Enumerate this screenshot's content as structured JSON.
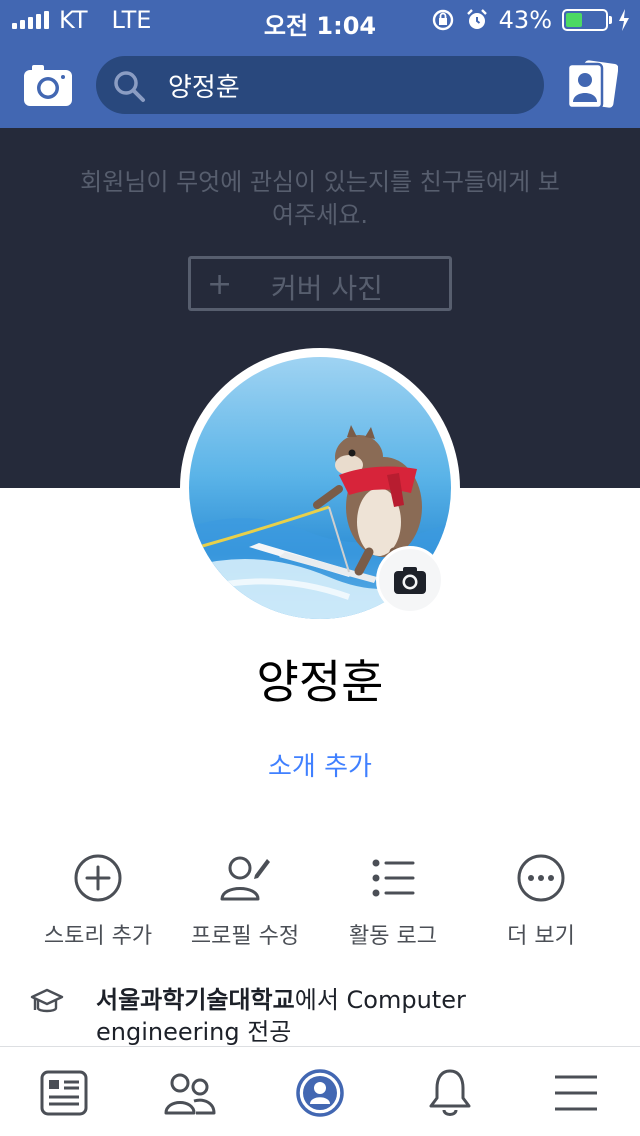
{
  "status_bar": {
    "carrier": "KT",
    "network": "LTE",
    "time": "오전 1:04",
    "battery_percent": "43%",
    "battery_level": 0.43
  },
  "nav": {
    "search_value": "양정훈"
  },
  "cover": {
    "message": "회원님이 무엇에 관심이 있는지를 친구들에게 보여주세요.",
    "add_cover_plus": "+",
    "add_cover_label": "커버 사진"
  },
  "profile": {
    "name": "양정훈",
    "add_bio": "소개 추가"
  },
  "actions": [
    {
      "label": "스토리 추가",
      "icon": "plus-circle-icon"
    },
    {
      "label": "프로필 수정",
      "icon": "edit-profile-icon"
    },
    {
      "label": "활동 로그",
      "icon": "list-icon"
    },
    {
      "label": "더 보기",
      "icon": "more-icon"
    }
  ],
  "education": {
    "school": "서울과학기술대학교",
    "suffix": "에서 Computer engineering 전공"
  },
  "tabs": [
    {
      "icon": "news-feed-icon"
    },
    {
      "icon": "friends-icon"
    },
    {
      "icon": "profile-icon",
      "active": true
    },
    {
      "icon": "notifications-icon"
    },
    {
      "icon": "menu-icon"
    }
  ],
  "colors": {
    "brand_blue": "#4267b2",
    "link_blue": "#4080ff",
    "cover_bg": "#252a3a"
  }
}
